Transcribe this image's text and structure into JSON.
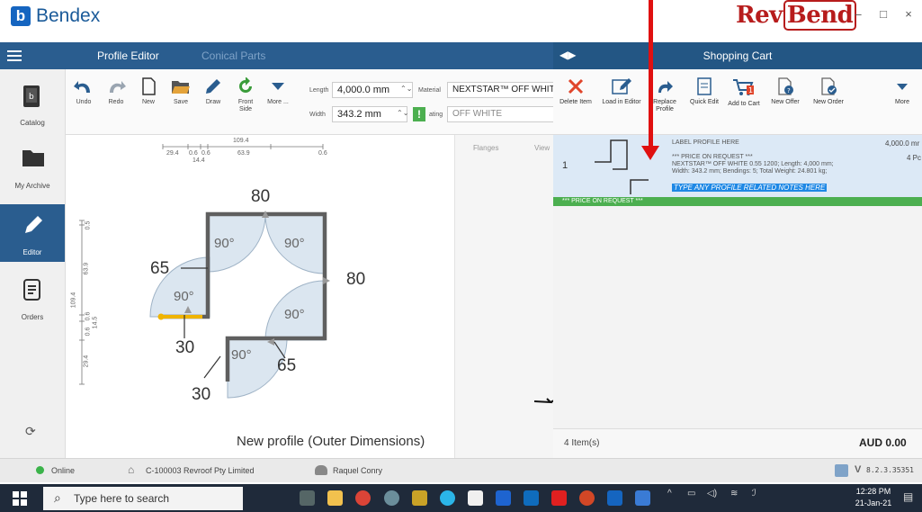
{
  "title_bar": {
    "app_name": "Bendex",
    "brand_left": "Rev",
    "brand_right": "Bend",
    "minimize": "–",
    "maximize": "□",
    "close": "×"
  },
  "nav": {
    "tabs": [
      {
        "label": "Profile Editor"
      },
      {
        "label": "Conical Parts"
      }
    ],
    "cart_title": "Shopping Cart"
  },
  "sidebar": {
    "items": [
      {
        "label": "Catalog"
      },
      {
        "label": "My Archive"
      },
      {
        "label": "Editor"
      },
      {
        "label": "Orders"
      }
    ]
  },
  "toolbar": {
    "buttons": [
      {
        "label": "Undo"
      },
      {
        "label": "Redo"
      },
      {
        "label": "New"
      },
      {
        "label": "Save"
      },
      {
        "label": "Draw"
      },
      {
        "label": "Front Side"
      },
      {
        "label": "More ..."
      }
    ],
    "length_label": "Length",
    "length_value": "4,000.0 mm",
    "width_label": "Width",
    "width_value": "343.2 mm",
    "material_label": "Material",
    "material_value": "NEXTSTAR™ OFF WHITE",
    "coating_label": "ating",
    "coating_value": "OFF WHITE",
    "warning": "!"
  },
  "drawing": {
    "dims_top": {
      "overall": "109.4",
      "d1": "29.4",
      "d2": "0.6",
      "d3": "0.6",
      "d4": "63.9",
      "d5": "0.6",
      "sub": "14.4"
    },
    "dims_left": {
      "overall": "109.4",
      "d1": "0.5",
      "d2": "63.9",
      "d3": "0.6",
      "d4": "0.6",
      "d5": "14.5",
      "d6": "29.4"
    },
    "labels": {
      "top": "80",
      "right": "80",
      "left": "65",
      "bottom_right": "65",
      "bottom_left": "30",
      "bottom": "30"
    },
    "angles": {
      "a1": "90°",
      "a2": "90°",
      "a3": "90°",
      "a4": "90°",
      "a5": "90°"
    },
    "caption": "New profile (Outer Dimensions)",
    "side_tabs": [
      "Flanges",
      "View"
    ]
  },
  "cart_toolbar": {
    "buttons": [
      {
        "label": "Delete Item"
      },
      {
        "label": "Load in Editor"
      },
      {
        "label": "Replace Profile"
      },
      {
        "label": "Quick Edit"
      },
      {
        "label": "Add to Cart"
      },
      {
        "label": "New Offer"
      },
      {
        "label": "New Order"
      },
      {
        "label": "More"
      }
    ]
  },
  "cart": {
    "item": {
      "number": "1",
      "label": "LABEL PROFILE HERE",
      "price_req": "*** PRICE ON REQUEST ***",
      "spec1": "NEXTSTAR™ OFF WHITE 0.55 1200; Length: 4,000 mm;",
      "spec2": "Width: 343.2 mm; Bendings: 5; Total Weight: 24.801 kg;",
      "note": "TYPE ANY PROFILE RELATED NOTES HERE",
      "length": "4,000.0 mr",
      "pieces": "4 Pc",
      "strip": "*** PRICE ON REQUEST ***"
    },
    "count": "4 Item(s)",
    "total": "AUD 0.00"
  },
  "status": {
    "online": "Online",
    "customer": "C-100003 Revroof Pty Limited",
    "user": "Raquel Conry",
    "version": "8.2.3.35351"
  },
  "taskbar": {
    "search_placeholder": "Type here to search",
    "time": "12:28 PM",
    "date": "21-Jan-21"
  },
  "colors": {
    "nav_blue": "#2a5d8f",
    "red_arrow": "#e01010",
    "price_green": "#4caf50",
    "highlight_yellow": "#f0b400"
  }
}
